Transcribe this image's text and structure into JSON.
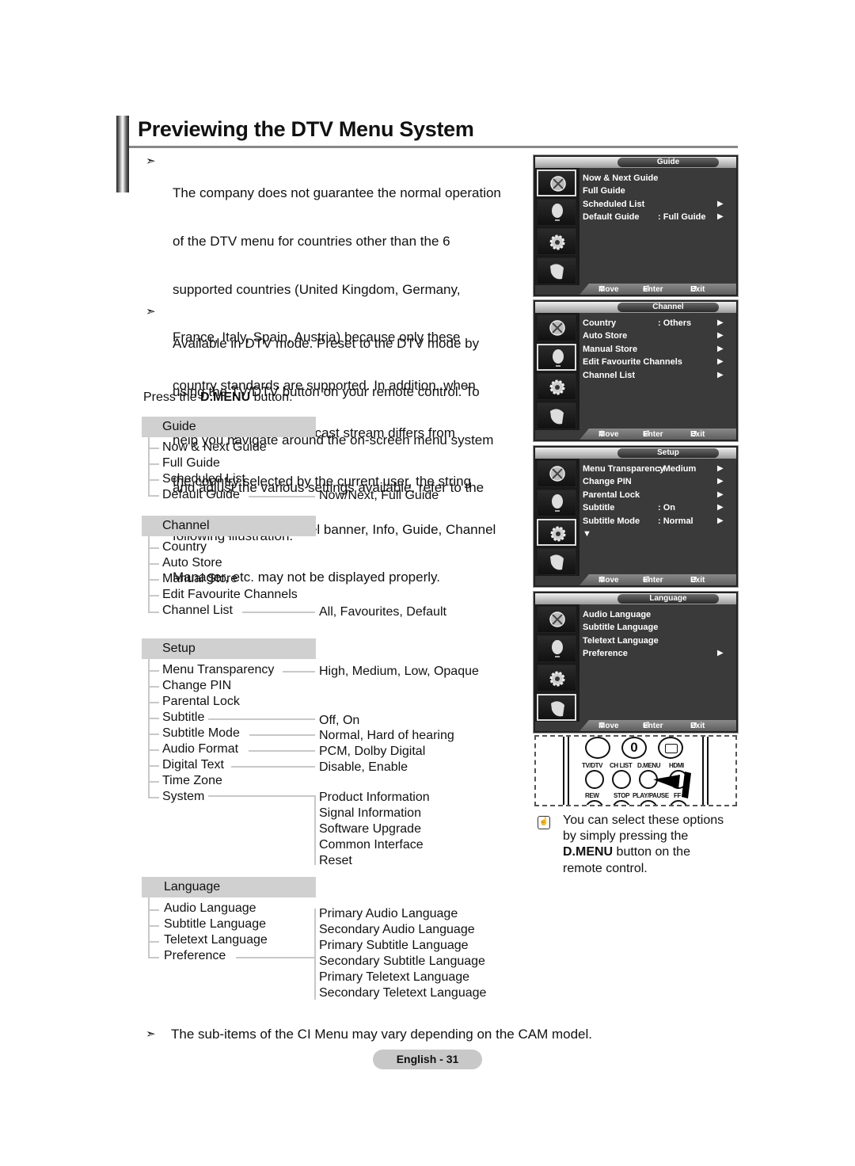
{
  "page": {
    "title": "Previewing the DTV Menu System",
    "page_label": "English - 31"
  },
  "notes": [
    {
      "icon": "arrow-right-icon",
      "glyph": "➣",
      "lines": [
        "The company does not guarantee the normal operation",
        "of the DTV menu for countries other than the 6",
        "supported countries (United Kingdom, Germany,",
        "France, Italy, Spain, Austria) because only these",
        "country standards are supported. In addition, when",
        "the country of the broadcast stream differs from",
        "the country selected by the current user, the string",
        "appearing in the channel banner, Info, Guide, Channel",
        "Manager, etc. may not be displayed properly."
      ]
    },
    {
      "icon": "arrow-right-icon",
      "glyph": "➣",
      "lines": [
        "Available in DTV mode. Preset to the DTV mode by",
        "using the TV/DTV button on your remote control. To",
        "help you navigate around the on-screen menu system",
        "and adjust the various settings available, refer to the",
        "following illustration."
      ]
    }
  ],
  "press_instruction": {
    "prefix": "Press the ",
    "bold": "D.MENU",
    "suffix": " button."
  },
  "tree": {
    "guide": {
      "label": "Guide",
      "items": [
        "Now & Next Guide",
        "Full Guide",
        "Scheduled List",
        "Default Guide"
      ],
      "options": {
        "Default Guide": "Now/Next, Full Guide"
      }
    },
    "channel": {
      "label": "Channel",
      "items": [
        "Country",
        "Auto Store",
        "Manual Store",
        "Edit Favourite Channels",
        "Channel List"
      ],
      "options": {
        "Channel List": "All, Favourites, Default"
      }
    },
    "setup": {
      "label": "Setup",
      "items": [
        "Menu Transparency",
        "Change PIN",
        "Parental Lock",
        "Subtitle",
        "Subtitle Mode",
        "Audio Format",
        "Digital Text",
        "Time Zone",
        "System"
      ],
      "options": {
        "Menu Transparency": "High, Medium, Low, Opaque",
        "Subtitle": "Off, On",
        "Subtitle Mode": "Normal, Hard of hearing",
        "Audio Format": "PCM, Dolby Digital",
        "Digital Text": "Disable, Enable"
      },
      "system_options": [
        "Product Information",
        "Signal Information",
        "Software Upgrade",
        "Common Interface",
        "Reset"
      ]
    },
    "language": {
      "label": "Language",
      "items": [
        "Audio Language",
        "Subtitle Language",
        "Teletext Language",
        "Preference"
      ],
      "preference_options": [
        "Primary Audio Language",
        "Secondary Audio Language",
        "Primary Subtitle Language",
        "Secondary Subtitle Language",
        "Primary Teletext Language",
        "Secondary Teletext Language"
      ]
    }
  },
  "osd_screens": [
    {
      "title": "Guide",
      "selected_icon": 0,
      "rows": [
        {
          "label": "Now & Next Guide",
          "value": "",
          "arrow": false
        },
        {
          "label": "Full Guide",
          "value": "",
          "arrow": false
        },
        {
          "label": "Scheduled List",
          "value": "",
          "arrow": true
        },
        {
          "label": "Default Guide",
          "value": ": Full Guide",
          "arrow": true
        }
      ],
      "more_arrow": false
    },
    {
      "title": "Channel",
      "selected_icon": 1,
      "rows": [
        {
          "label": "Country",
          "value": ": Others",
          "arrow": true
        },
        {
          "label": "Auto Store",
          "value": "",
          "arrow": true
        },
        {
          "label": "Manual Store",
          "value": "",
          "arrow": true
        },
        {
          "label": "Edit Favourite Channels",
          "value": "",
          "arrow": true
        },
        {
          "label": "Channel List",
          "value": "",
          "arrow": true
        }
      ],
      "more_arrow": false
    },
    {
      "title": "Setup",
      "selected_icon": 2,
      "rows": [
        {
          "label": "Menu Transparency",
          "value": ": Medium",
          "arrow": true
        },
        {
          "label": "Change PIN",
          "value": "",
          "arrow": true
        },
        {
          "label": "Parental Lock",
          "value": "",
          "arrow": true
        },
        {
          "label": "Subtitle",
          "value": ": On",
          "arrow": true
        },
        {
          "label": "Subtitle  Mode",
          "value": ": Normal",
          "arrow": true
        }
      ],
      "more_arrow": true
    },
    {
      "title": "Language",
      "selected_icon": 3,
      "rows": [
        {
          "label": "Audio Language",
          "value": "",
          "arrow": false
        },
        {
          "label": "Subtitle Language",
          "value": "",
          "arrow": false
        },
        {
          "label": "Teletext Language",
          "value": "",
          "arrow": false
        },
        {
          "label": "Preference",
          "value": "",
          "arrow": true
        }
      ],
      "more_arrow": false
    }
  ],
  "osd_footer": {
    "move": "Move",
    "enter": "Enter",
    "exit": "Exit"
  },
  "osd_icons": [
    "guide-satellite-dish-icon",
    "channel-antenna-icon",
    "setup-gear-icon",
    "language-hand-icon"
  ],
  "remote": {
    "top_button_zero": "0",
    "labels_row1": [
      "TV/DTV",
      "CH LIST",
      "D.MENU",
      "HDMI"
    ],
    "labels_row2": [
      "REW",
      "STOP",
      "PLAY/PAUSE",
      "FF"
    ]
  },
  "hint": {
    "icon": "hand-press-icon",
    "line1": "You can select these options",
    "line2": "by simply pressing the",
    "bold": "D.MENU",
    "line3_suffix": " button on the",
    "line4": "remote control."
  },
  "footer_note": {
    "glyph": "➣",
    "text": "The sub-items of the CI Menu may vary depending on the CAM model."
  }
}
